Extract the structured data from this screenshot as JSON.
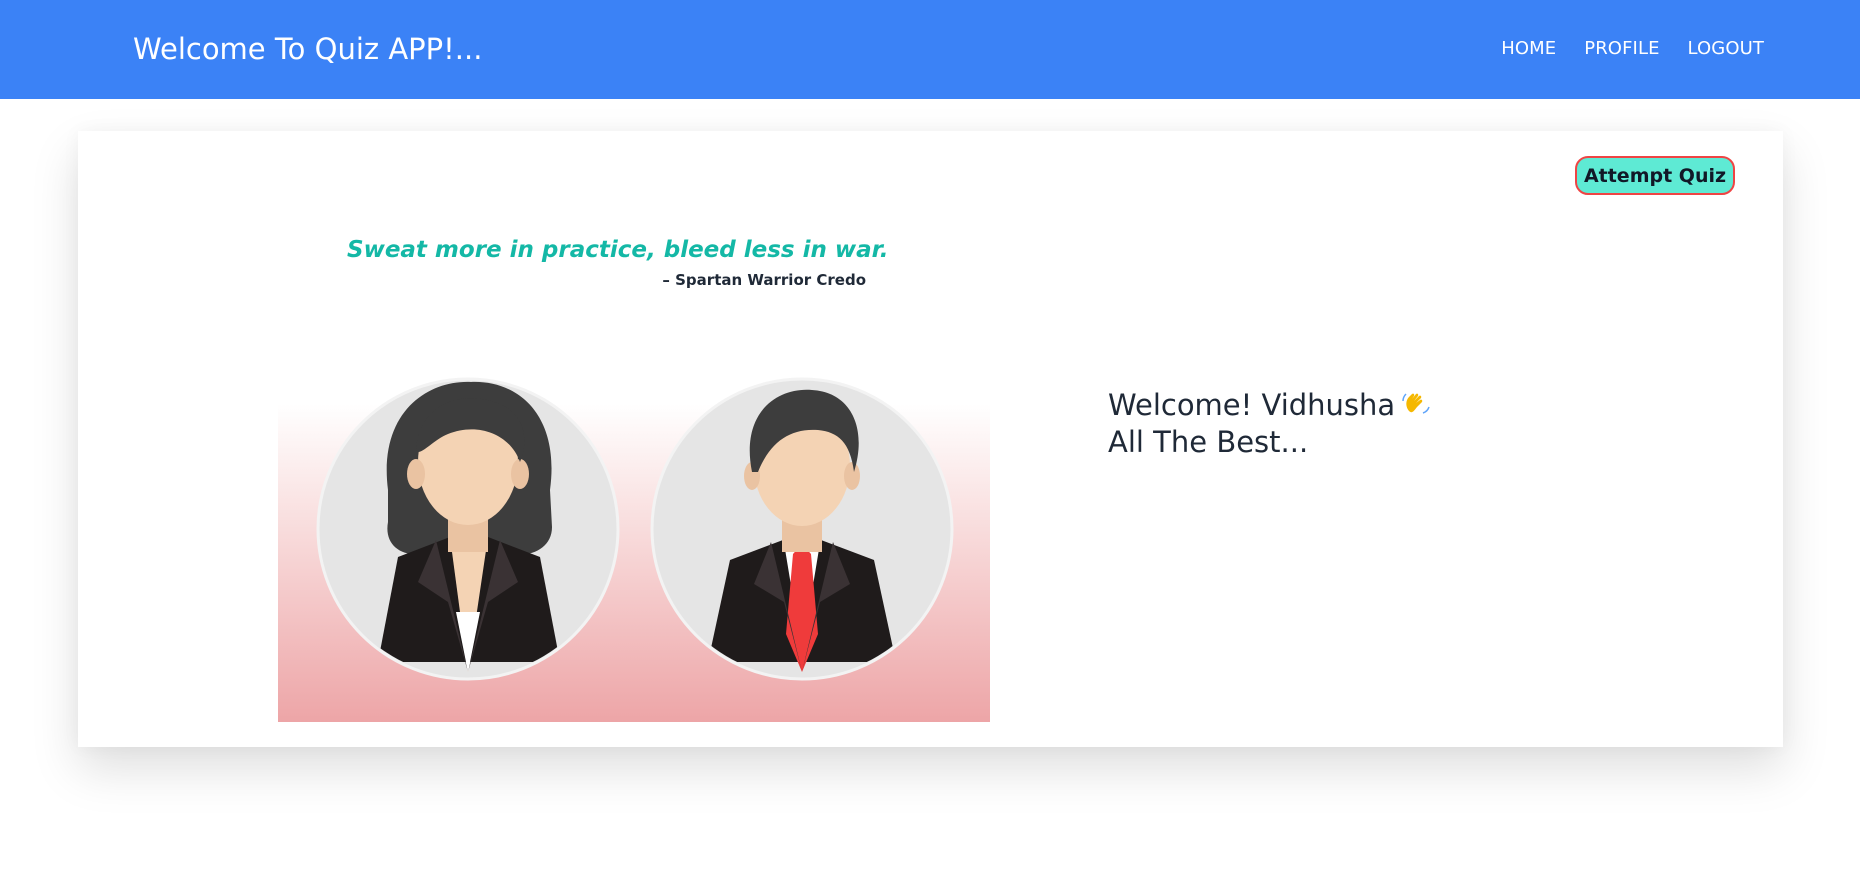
{
  "navbar": {
    "brand": "Welcome To Quiz APP!...",
    "links": [
      "HOME",
      "PROFILE",
      "LOGOUT"
    ]
  },
  "card": {
    "attempt_button": "Attempt Quiz",
    "quote": "Sweat more in practice, bleed less in war.",
    "quote_author": "– Spartan Warrior Credo",
    "greeting_line1": "Welcome! Vidhusha",
    "greeting_line2": "All The Best...",
    "greeting_icon": "waving-hand-icon"
  },
  "colors": {
    "navbar": "#3b82f6",
    "quote": "#14b8a6",
    "button_bg": "#5eead4",
    "button_border": "#ef4444",
    "tie": "#ef4444"
  }
}
